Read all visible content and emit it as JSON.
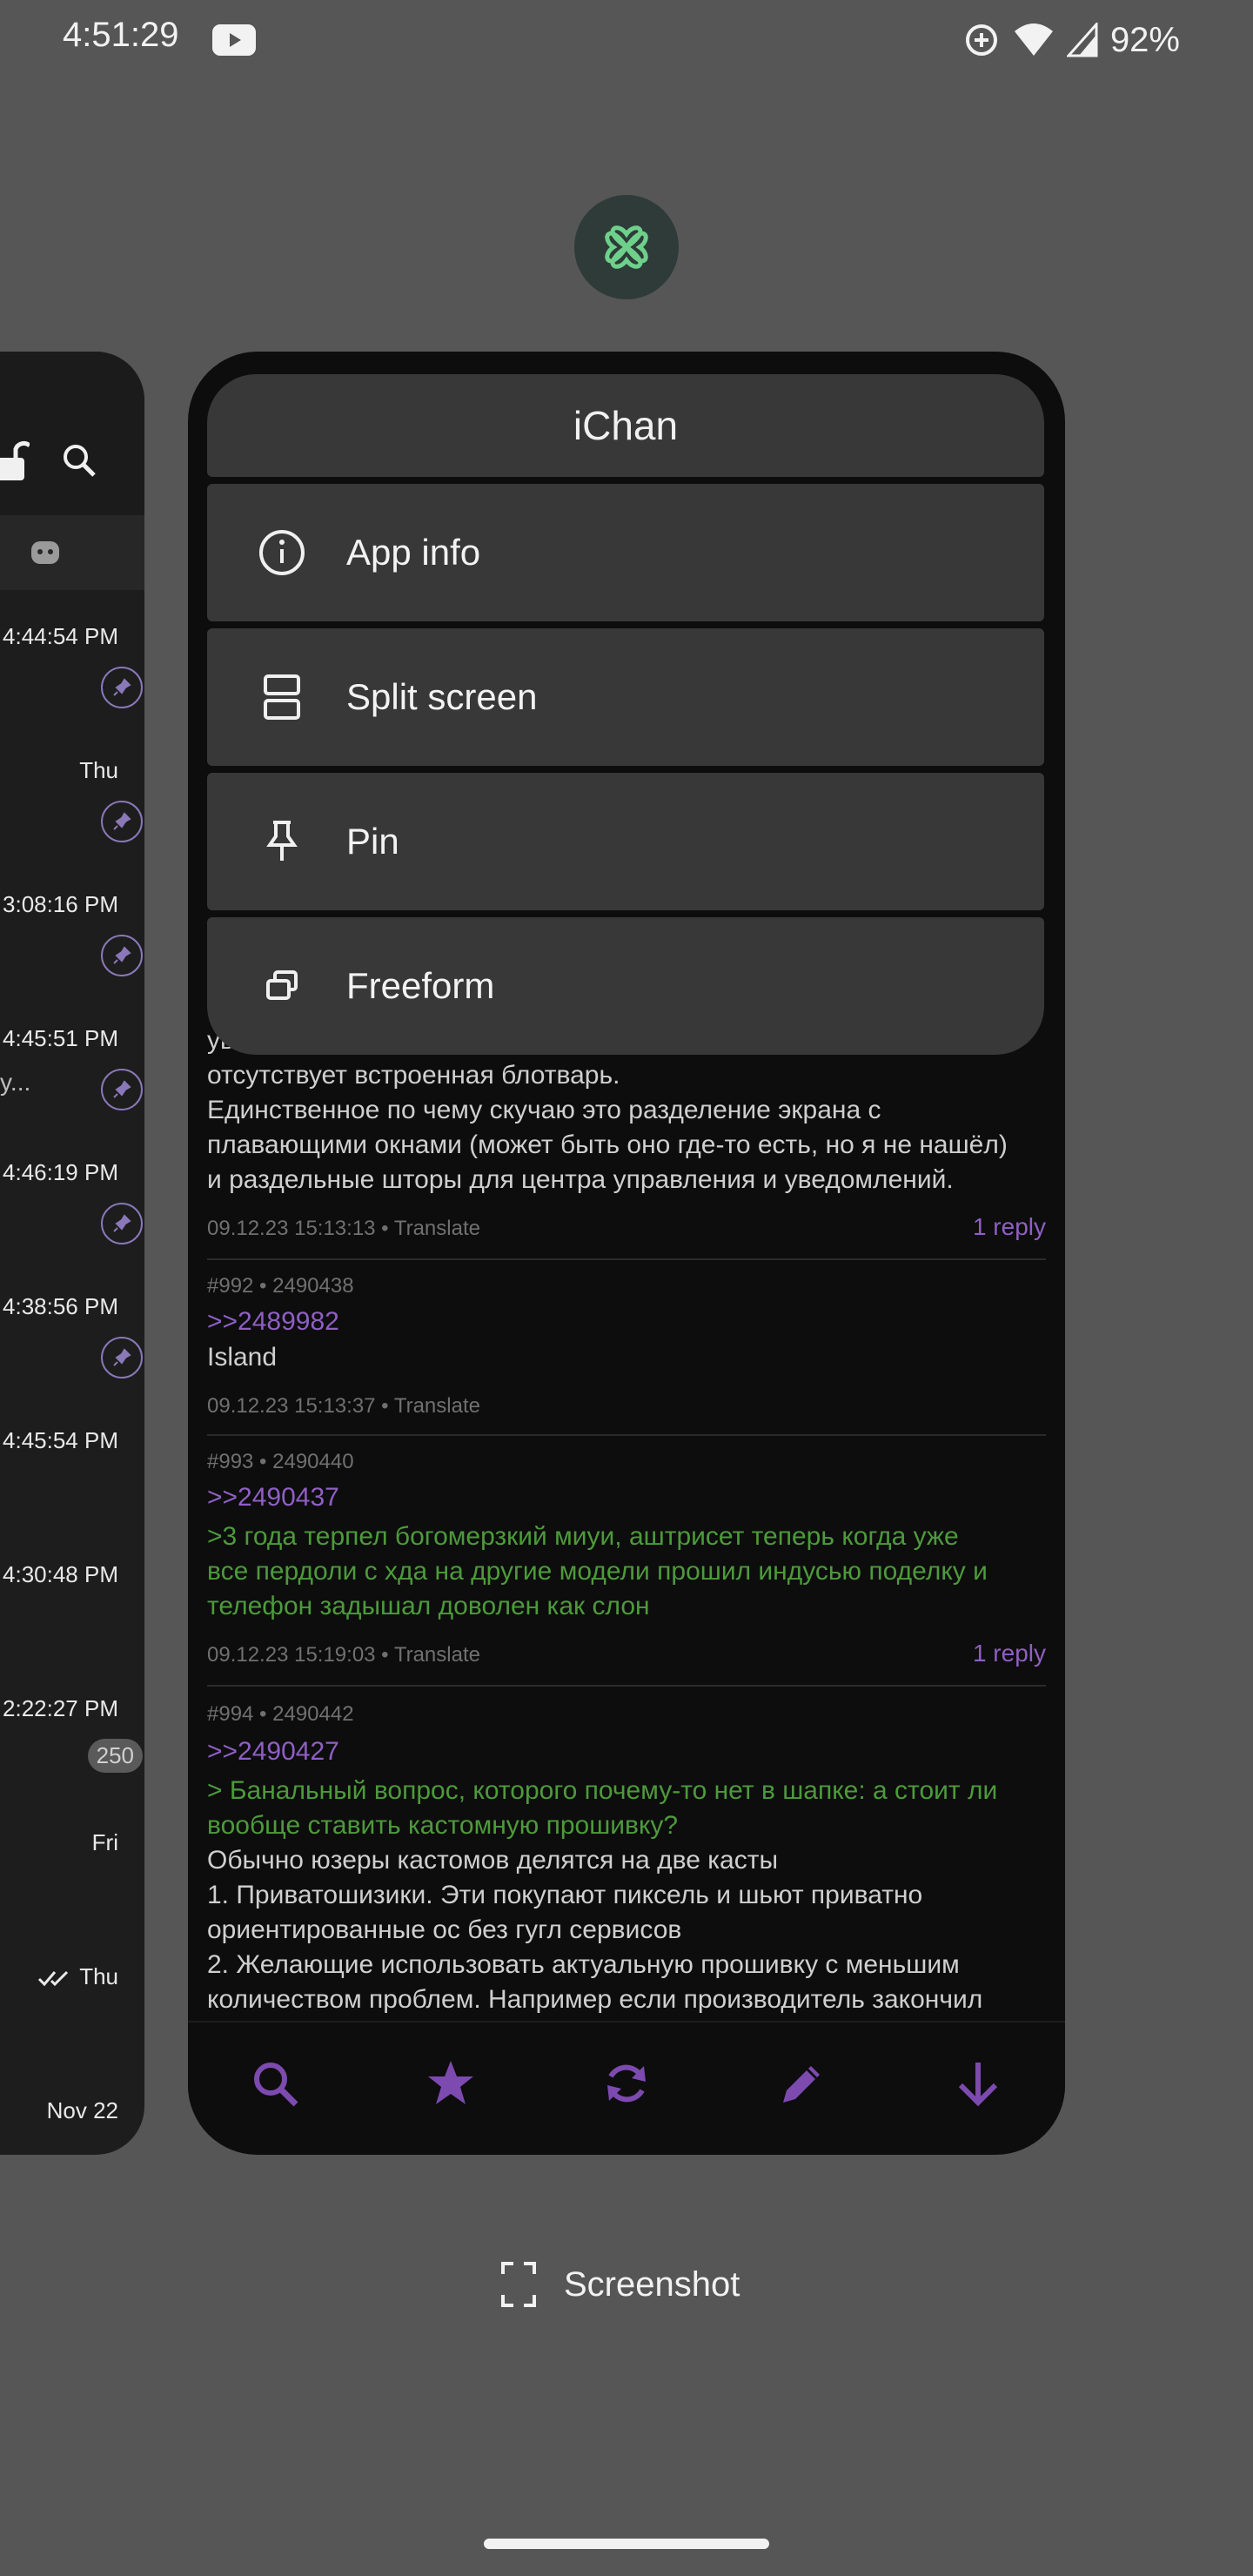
{
  "status_bar": {
    "time": "4:51:29",
    "battery": "92%",
    "icons": [
      "youtube-icon",
      "data-saver-icon",
      "wifi-icon",
      "signal-icon"
    ]
  },
  "left_card": {
    "rows": [
      {
        "time": "4:44:54 PM",
        "pinned": true
      },
      {
        "time": "Thu",
        "pinned": true
      },
      {
        "time": "3:08:16 PM",
        "pinned": true
      },
      {
        "time": "4:45:51 PM",
        "sub": "y...",
        "pinned": true
      },
      {
        "time": "4:46:19 PM",
        "pinned": true
      },
      {
        "time": "4:38:56 PM",
        "pinned": true
      },
      {
        "time": "4:45:54 PM"
      },
      {
        "time": "4:30:48 PM"
      },
      {
        "time": "2:22:27 PM",
        "badge": "250"
      },
      {
        "time": "Fri"
      },
      {
        "time": "Thu",
        "read": true
      },
      {
        "time": "Nov 22"
      }
    ]
  },
  "app_card": {
    "app_name": "iChan",
    "menu": [
      {
        "label": "App info",
        "icon": "info-icon"
      },
      {
        "label": "Split screen",
        "icon": "split-screen-icon"
      },
      {
        "label": "Pin",
        "icon": "pin-icon"
      },
      {
        "label": "Freeform",
        "icon": "freeform-icon"
      }
    ],
    "thread": {
      "partial_lines": [
        "уве",
        "отсутствует встроенная блотварь.",
        "Единственное по чему скучаю это разделение экрана с",
        "плавающими окнами (может быть оно где-то есть, но я не нашёл)",
        "и раздельные шторы для центра управления и уведомлений."
      ],
      "partial_meta": "09.12.23 15:13:13 • Translate",
      "partial_reply": "1 reply",
      "posts": [
        {
          "head": "#992 • 2490438",
          "link": ">>2489982",
          "body": [
            "Island"
          ],
          "meta": "09.12.23 15:13:37 • Translate"
        },
        {
          "head": "#993 • 2490440",
          "link": ">>2490437",
          "green": [
            ">3 года терпел богомерзкий миуи, аштрисет теперь когда уже",
            "все пердоли с хда на другие модели прошил индусью поделку и",
            "телефон задышал доволен как слон"
          ],
          "meta": "09.12.23 15:19:03 • Translate",
          "reply": "1 reply"
        },
        {
          "head": "#994 • 2490442",
          "link": ">>2490427",
          "green": [
            "> Банальный вопрос, которого почему-то нет в шапке: а стоит ли",
            "вообще ставить кастомную прошивку?"
          ],
          "body": [
            "Обычно юзеры кастомов делятся на две касты",
            "1. Приватошизики. Эти покупают пиксель и шьют приватно",
            "ориентированные ос без гугл сервисов",
            "2. Желающие использовать актуальную прошивку с меньшим",
            "количеством проблем. Например если производитель закончил"
          ]
        }
      ]
    },
    "bottom_nav": [
      "search-icon",
      "star-icon",
      "refresh-icon",
      "edit-icon",
      "arrow-down-icon"
    ],
    "accent": "#8f5fc4"
  },
  "screenshot_label": "Screenshot"
}
